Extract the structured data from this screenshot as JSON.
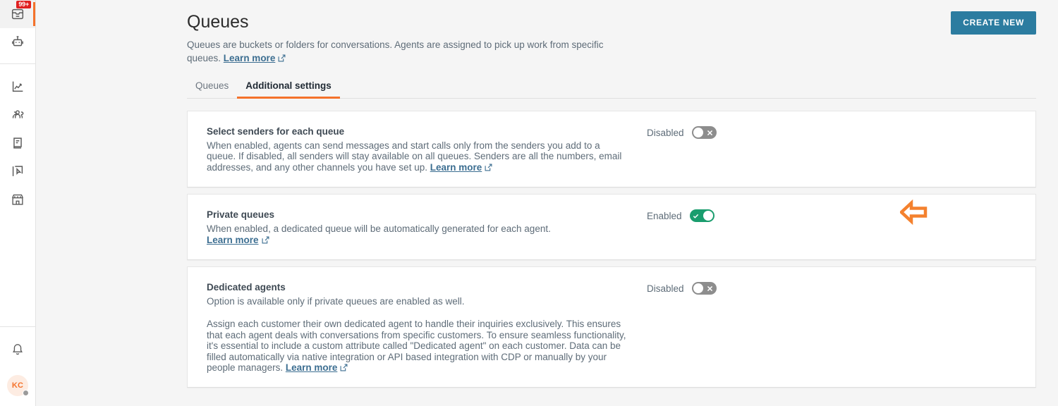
{
  "sidebar": {
    "items": [
      {
        "name": "inbox-icon",
        "label": "Inbox",
        "badge": "99+",
        "active": true
      },
      {
        "name": "bot-icon",
        "label": "Bots",
        "badge": "",
        "active": false
      },
      {
        "name": "analytics-icon",
        "label": "Analytics",
        "badge": "",
        "active": false
      },
      {
        "name": "team-icon",
        "label": "Team",
        "badge": "",
        "active": false
      },
      {
        "name": "knowledge-base-icon",
        "label": "Knowledge base",
        "badge": "",
        "active": false
      },
      {
        "name": "automations-icon",
        "label": "Automations",
        "badge": "",
        "active": false
      },
      {
        "name": "storefront-icon",
        "label": "Store",
        "badge": "",
        "active": false
      }
    ],
    "notifications_icon": "bell-icon",
    "avatar_initials": "KC"
  },
  "header": {
    "title": "Queues",
    "description_before_link": "Queues are buckets or folders for conversations. Agents are assigned to pick up work from specific queues. ",
    "learn_more": "Learn more",
    "create_button": "CREATE NEW"
  },
  "tabs": [
    {
      "label": "Queues",
      "active": false
    },
    {
      "label": "Additional settings",
      "active": true
    }
  ],
  "cards": [
    {
      "title": "Select senders for each queue",
      "paragraphs": [
        "When enabled, agents can send messages and start calls only from the senders you add to a queue. If disabled, all senders will stay available on all queues. Senders are all the numbers, email addresses, and any other channels you have set up. "
      ],
      "learn_more": "Learn more",
      "status_label": "Disabled",
      "enabled": false
    },
    {
      "title": "Private queues",
      "paragraphs": [
        "When enabled, a dedicated queue will be automatically generated for each agent. "
      ],
      "learn_more": "Learn more",
      "status_label": "Enabled",
      "enabled": true
    },
    {
      "title": "Dedicated agents",
      "subtitle": "Option is available only if private queues are enabled as well.",
      "paragraphs": [
        "Assign each customer their own dedicated agent to handle their inquiries exclusively. This ensures that each agent deals with conversations from specific customers. To ensure seamless functionality, it's essential to include a custom attribute called \"Dedicated agent\" on each customer. Data can be filled automatically via native integration or API based integration with CDP or manually by your people managers. "
      ],
      "learn_more": "Learn more",
      "status_label": "Disabled",
      "enabled": false
    }
  ],
  "annotation": {
    "name": "left-pointing-arrow",
    "color": "#f4812e"
  },
  "colors": {
    "accent_orange": "#f4722b",
    "primary_button": "#2c7ca0",
    "toggle_on": "#1a9d6e",
    "toggle_off": "#8d8d8d",
    "badge_red": "#e02020",
    "link": "#3c6e91",
    "page_background": "#f5f5f5"
  }
}
